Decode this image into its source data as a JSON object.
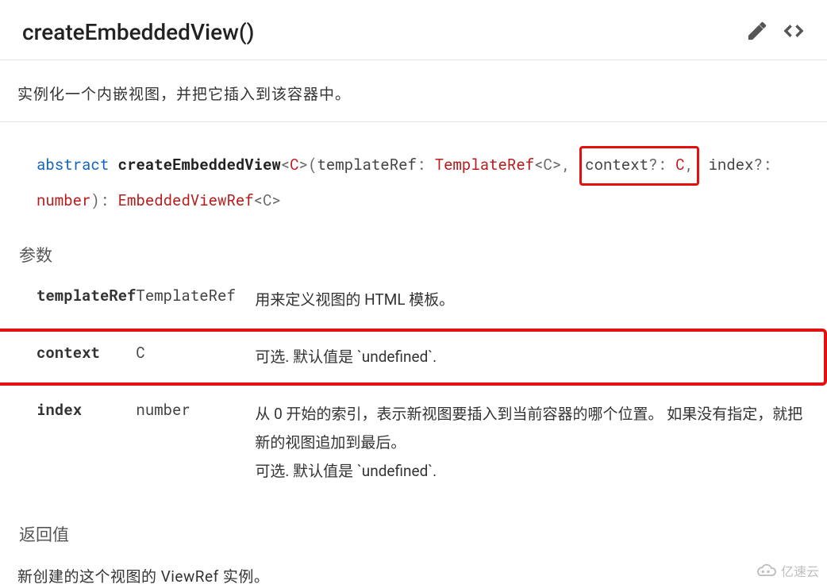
{
  "header": {
    "title": "createEmbeddedView()"
  },
  "intro": "实例化一个内嵌视图，并把它插入到该容器中。",
  "signature": {
    "abstract": "abstract",
    "name": "createEmbeddedView",
    "generic_open": "<",
    "generic_C": "C",
    "generic_close": ">",
    "paren_open": "(",
    "p1_name": "templateRef",
    "colon": ": ",
    "p1_type": "TemplateRef",
    "p1_gen": "<C>",
    "comma": ", ",
    "p2_name": "context",
    "opt": "?",
    "p2_type": "C",
    "p3_name": "index",
    "p3_type": "number",
    "paren_close": ")",
    "ret_type": "EmbeddedViewRef",
    "ret_gen": "<C>"
  },
  "params_heading": "参数",
  "params": [
    {
      "name": "templateRef",
      "type": "TemplateRef",
      "desc": "用来定义视图的 HTML 模板。"
    },
    {
      "name": "context",
      "type": "C",
      "desc": "可选. 默认值是 `undefined`."
    },
    {
      "name": "index",
      "type": "number",
      "desc": "从 0 开始的索引，表示新视图要插入到当前容器的哪个位置。 如果没有指定，就把新的视图追加到最后。\n可选. 默认值是 `undefined`."
    }
  ],
  "returns_heading": "返回值",
  "returns_desc": "新创建的这个视图的 ViewRef 实例。",
  "watermark": "亿速云"
}
